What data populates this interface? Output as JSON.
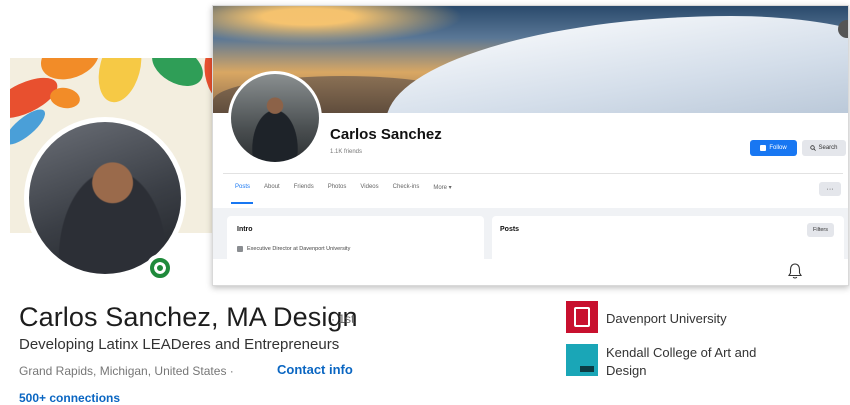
{
  "linkedin": {
    "name": "Carlos Sanchez, MA Design",
    "degree": "· 1st",
    "headline": "Developing Latinx LEADeres and Entrepreneurs",
    "location": "Grand Rapids, Michigan, United States ·",
    "contact_label": "Contact info",
    "connections": "500+ connections",
    "organizations": [
      {
        "name": "Davenport University",
        "logo": "davenport-logo",
        "color": "#c8102e"
      },
      {
        "name": "Kendall College of Art and Design",
        "logo": "kendall-logo",
        "color": "#1aa6b7"
      }
    ],
    "status_color": "#1f8a3b"
  },
  "facebook": {
    "name": "Carlos Sanchez",
    "friends": "1.1K friends",
    "follow_label": "Follow",
    "search_label": "Search",
    "tabs": [
      "Posts",
      "About",
      "Friends",
      "Photos",
      "Videos",
      "Check-ins",
      "More ▾"
    ],
    "more_dots": "···",
    "intro_title": "Intro",
    "intro_line": "Executive Director at Davenport University",
    "posts_title": "Posts",
    "filters_label": "Filters",
    "accent_color": "#1877f2"
  }
}
